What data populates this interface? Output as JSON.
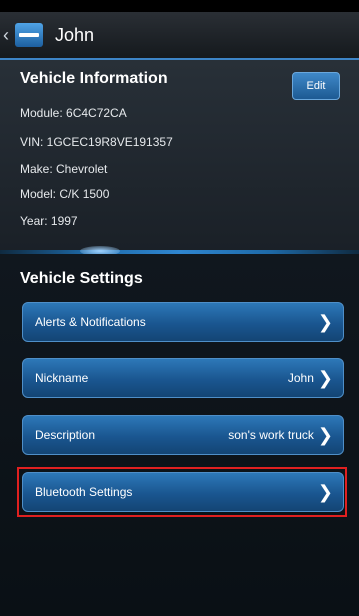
{
  "header": {
    "title": "John"
  },
  "vehicle_info": {
    "title": "Vehicle Information",
    "edit_label": "Edit",
    "module": "Module: 6C4C72CA",
    "vin": "VIN: 1GCEC19R8VE191357",
    "make": "Make: Chevrolet",
    "model": "Model: C/K 1500",
    "year": "Year: 1997"
  },
  "vehicle_settings": {
    "title": "Vehicle Settings",
    "items": [
      {
        "label": "Alerts & Notifications",
        "value": ""
      },
      {
        "label": "Nickname",
        "value": "John"
      },
      {
        "label": "Description",
        "value": "son's work truck"
      },
      {
        "label": "Bluetooth Settings",
        "value": ""
      }
    ]
  },
  "colors": {
    "accent": "#2f86d0",
    "highlight": "#e02020"
  }
}
